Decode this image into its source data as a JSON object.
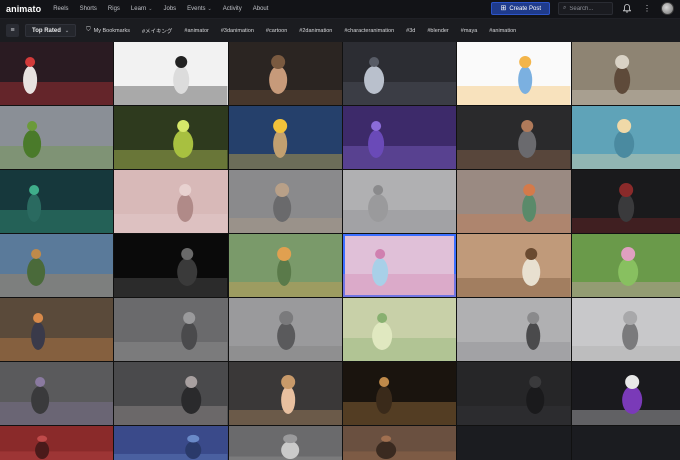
{
  "app": {
    "logo": "animato"
  },
  "nav": {
    "items": [
      {
        "label": "Reels",
        "caret": false
      },
      {
        "label": "Shorts",
        "caret": false
      },
      {
        "label": "Rigs",
        "caret": false
      },
      {
        "label": "Learn",
        "caret": true
      },
      {
        "label": "Jobs",
        "caret": false
      },
      {
        "label": "Events",
        "caret": true
      },
      {
        "label": "Activity",
        "caret": false
      },
      {
        "label": "About",
        "caret": false
      }
    ],
    "create_label": "Create Post",
    "search_placeholder": "Search..."
  },
  "filters": {
    "sort_value": "Top Rated",
    "tags": [
      "My Bookmarks",
      "#メイキング",
      "#animator",
      "#3danimation",
      "#cartoon",
      "#2danimation",
      "#characteranimation",
      "#3d",
      "#blender",
      "#maya",
      "#animation"
    ]
  },
  "thumbnails": [
    {
      "bg": "#2a1b22",
      "accent": "#d23a3a",
      "fig": "#e8e2e0"
    },
    {
      "bg": "#f2f2f2",
      "accent": "#222222",
      "fig": "#dcdcdc"
    },
    {
      "bg": "#2b2522",
      "accent": "#7a5a40",
      "fig": "#c79a7a"
    },
    {
      "bg": "#2c2d33",
      "accent": "#585c66",
      "fig": "#b9c0cc"
    },
    {
      "bg": "#fafafa",
      "accent": "#f3b54a",
      "fig": "#7bb0e0"
    },
    {
      "bg": "#8e8473",
      "accent": "#d9d2c5",
      "fig": "#5e4a3a"
    },
    {
      "bg": "#8a8f96",
      "accent": "#6b9a3a",
      "fig": "#4a7a2a"
    },
    {
      "bg": "#2e3a1e",
      "accent": "#d6e86a",
      "fig": "#a8c040"
    },
    {
      "bg": "#25406b",
      "accent": "#f2c23a",
      "fig": "#c2a070"
    },
    {
      "bg": "#3d2a6a",
      "accent": "#8b6cd8",
      "fig": "#6a4ab8"
    },
    {
      "bg": "#2a2a2c",
      "accent": "#b07a5a",
      "fig": "#6a6a6e"
    },
    {
      "bg": "#5fa3b8",
      "accent": "#f0d9a8",
      "fig": "#4a8aa0"
    },
    {
      "bg": "#16383c",
      "accent": "#3fae8a",
      "fig": "#2a6a60"
    },
    {
      "bg": "#d8b9b8",
      "accent": "#e8d2d0",
      "fig": "#b08a88"
    },
    {
      "bg": "#8a8a8c",
      "accent": "#b8a088",
      "fig": "#6a6a6c"
    },
    {
      "bg": "#b0b0b2",
      "accent": "#8a8a8c",
      "fig": "#9a9a9c"
    },
    {
      "bg": "#9a8a82",
      "accent": "#d47a4a",
      "fig": "#5a8a6a"
    },
    {
      "bg": "#1a1a1c",
      "accent": "#8a2a2a",
      "fig": "#3a3a3c"
    },
    {
      "bg": "#5a7a9a",
      "accent": "#c08a4a",
      "fig": "#4a6a3a"
    },
    {
      "bg": "#0a0a0a",
      "accent": "#6a6a6a",
      "fig": "#3a3a3a"
    },
    {
      "bg": "#7a9a6a",
      "accent": "#e0a050",
      "fig": "#5a7a4a"
    },
    {
      "bg": "#e0c0d8",
      "accent": "#d080b0",
      "fig": "#a8d0e8"
    },
    {
      "bg": "#c09a7a",
      "accent": "#6a4a30",
      "fig": "#e8e0d0"
    },
    {
      "bg": "#6a9a4a",
      "accent": "#e0a0c0",
      "fig": "#88c060"
    },
    {
      "bg": "#5a4a3a",
      "accent": "#d88a4a",
      "fig": "#3a3a4a"
    },
    {
      "bg": "#6a6a6c",
      "accent": "#9a9a9c",
      "fig": "#4a4a4c"
    },
    {
      "bg": "#9a9a9c",
      "accent": "#7a7a7c",
      "fig": "#5a5a5c"
    },
    {
      "bg": "#c8d0a8",
      "accent": "#88b070",
      "fig": "#e0e8c0"
    },
    {
      "bg": "#b0b0b2",
      "accent": "#8a8a8c",
      "fig": "#4a4a4c"
    },
    {
      "bg": "#c8c8ca",
      "accent": "#a8a8aa",
      "fig": "#7a7a7c"
    },
    {
      "bg": "#5a5a5c",
      "accent": "#8a7aa0",
      "fig": "#3a3a3c"
    },
    {
      "bg": "#4a4a4c",
      "accent": "#a8a0a0",
      "fig": "#2a2a2c"
    },
    {
      "bg": "#3a3838",
      "accent": "#c89a6a",
      "fig": "#e8c0a0"
    },
    {
      "bg": "#1a140e",
      "accent": "#c08a4a",
      "fig": "#3a2a1a"
    },
    {
      "bg": "#262628",
      "accent": "#3a3a3c",
      "fig": "#1a1a1c"
    },
    {
      "bg": "#1a1a1e",
      "accent": "#e8e8e8",
      "fig": "#7a3ab8"
    },
    {
      "bg": "#8a2a2a",
      "accent": "#c04a4a",
      "fig": "#4a1a1a"
    },
    {
      "bg": "#3a4a8a",
      "accent": "#6a8ac8",
      "fig": "#2a3a6a"
    },
    {
      "bg": "#6a6a6c",
      "accent": "#9a9a9c",
      "fig": "#cacaca"
    },
    {
      "bg": "#6a5040",
      "accent": "#a07050",
      "fig": "#3a2a20"
    },
    {
      "bg": "#1b1c20",
      "accent": "#1b1c20",
      "fig": "#1b1c20"
    },
    {
      "bg": "#1b1c20",
      "accent": "#1b1c20",
      "fig": "#1b1c20"
    }
  ]
}
